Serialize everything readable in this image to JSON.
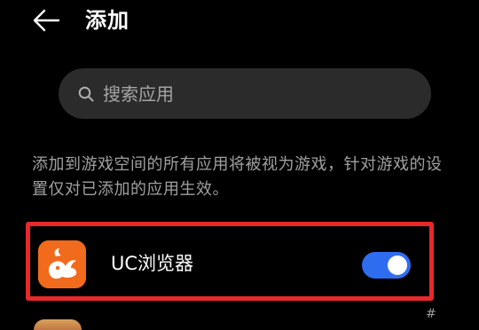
{
  "header": {
    "title": "添加",
    "back_icon": "arrow-left-icon"
  },
  "search": {
    "placeholder": "搜索应用",
    "value": "",
    "icon": "search-icon"
  },
  "description": "添加到游戏空间的所有应用将被视为游戏，针对游戏的设置仅对已添加的应用生效。",
  "apps": [
    {
      "name": "UC浏览器",
      "icon": "uc-browser-icon",
      "enabled": true
    }
  ],
  "corner_mark": "#",
  "colors": {
    "background": "#000000",
    "search_bg": "#2b2b2b",
    "highlight_border": "#e8282a",
    "toggle_on": "#2f6df0",
    "uc_icon_bg": "#f26a1b",
    "description_text": "#a0a0a0"
  }
}
